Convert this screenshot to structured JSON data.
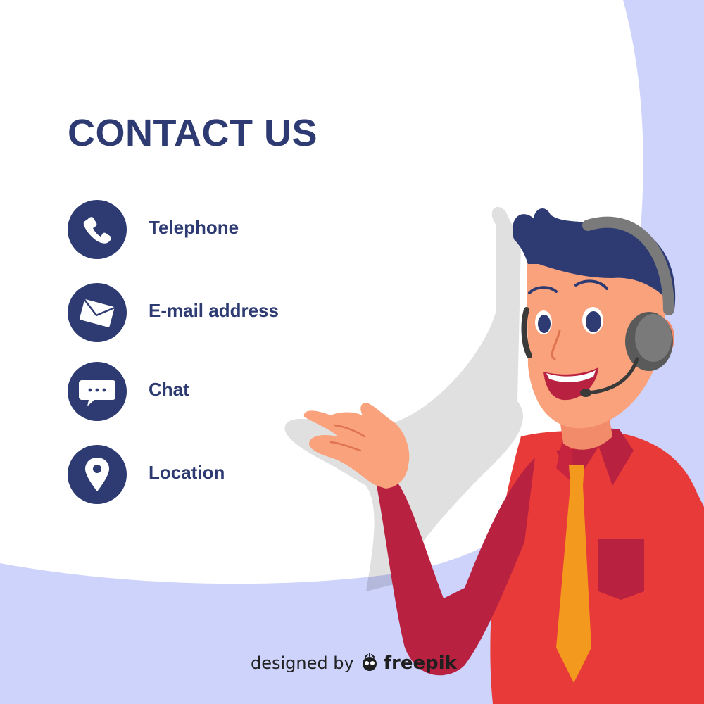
{
  "title": "CONTACT US",
  "contacts": [
    {
      "label": "Telephone",
      "icon": "phone-icon"
    },
    {
      "label": "E-mail address",
      "icon": "envelope-icon"
    },
    {
      "label": "Chat",
      "icon": "chat-bubble-icon"
    },
    {
      "label": "Location",
      "icon": "location-pin-icon"
    }
  ],
  "credit": {
    "prefix": "designed by",
    "brand": "freepik"
  },
  "colors": {
    "navy": "#2d3b72",
    "background_lavender": "#cdd3fb",
    "speech_area": "#ffffff",
    "shirt": "#e93a3a",
    "sleeve": "#b8213f",
    "tie": "#f3991e",
    "skin": "#f9a27c",
    "headset": "#7a7a7a"
  }
}
